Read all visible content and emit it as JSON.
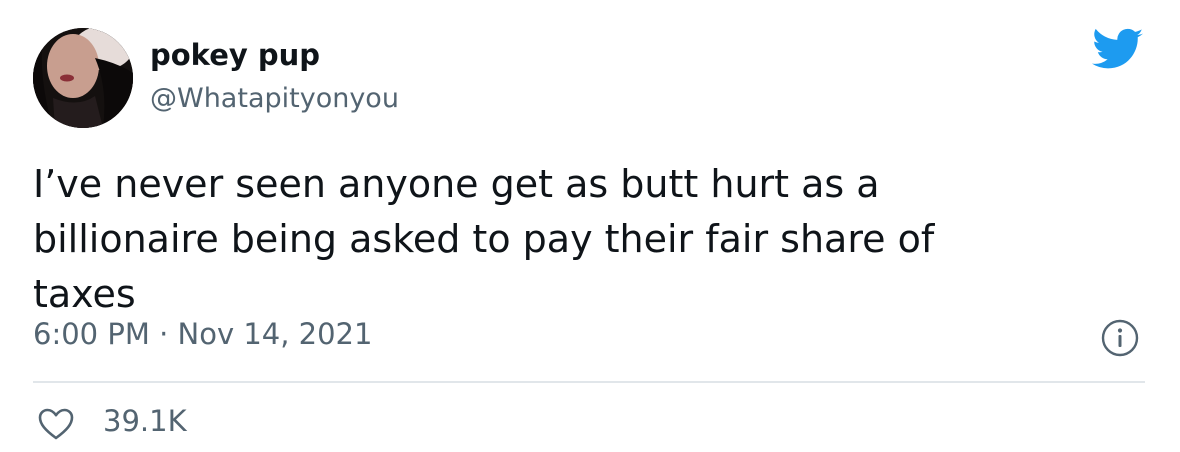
{
  "author": {
    "name": "pokey pup",
    "handle": "@Whatapityonyou",
    "avatar_icon": "avatar-photo"
  },
  "tweet": {
    "text": "I’ve never seen anyone get as butt hurt as a\nbillionaire being asked to pay their fair share of\ntaxes",
    "timestamp": "6:00 PM · Nov 14, 2021"
  },
  "engagement": {
    "likes": "39.1K",
    "like_icon": "heart-icon",
    "info_icon": "info-icon"
  },
  "brand": {
    "logo_icon": "twitter-bird-icon",
    "accent_color": "#1d9bf0",
    "secondary_text_color": "#536471"
  }
}
